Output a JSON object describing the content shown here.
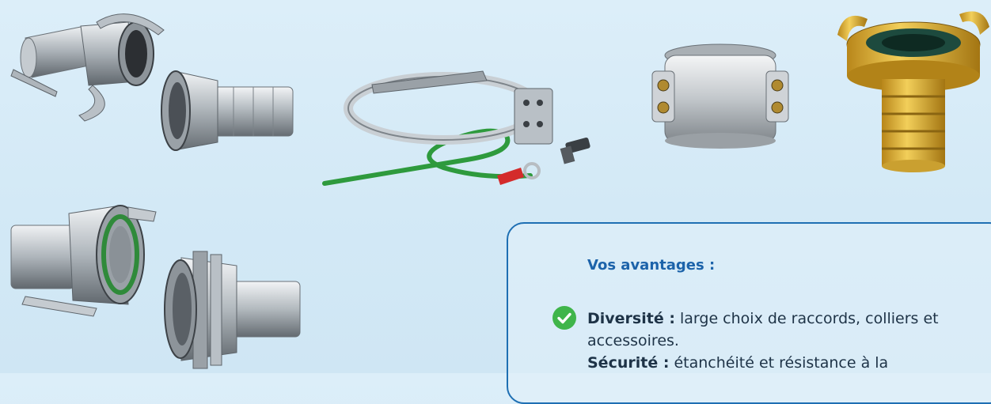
{
  "products": [
    {
      "name": "camlock-coupling-with-levers",
      "icon": "camlock-coupling-icon"
    },
    {
      "name": "hose-tail-ferrule",
      "icon": "hose-tail-icon"
    },
    {
      "name": "grounding-hose-clamp-with-cable",
      "icon": "grounding-clamp-icon"
    },
    {
      "name": "safety-clamp",
      "icon": "safety-clamp-icon"
    },
    {
      "name": "brass-claw-coupling",
      "icon": "claw-coupling-icon"
    },
    {
      "name": "guillemin-coupling",
      "icon": "guillemin-coupling-icon"
    },
    {
      "name": "threaded-hose-tail",
      "icon": "threaded-hose-tail-icon"
    }
  ],
  "panel": {
    "title": "Vos avantages :",
    "advantages": [
      {
        "term": "Diversité :",
        "text": "large choix de raccords, colliers et accessoires."
      },
      {
        "term": "Sécurité :",
        "text": "étanchéité et résistance à la"
      }
    ]
  },
  "colors": {
    "background": "#d6ebf7",
    "accent": "#1e6fb3",
    "title": "#1c63aa",
    "check": "#3fb54a",
    "brass": "#d9a624",
    "cable": "#2e9a3d"
  }
}
